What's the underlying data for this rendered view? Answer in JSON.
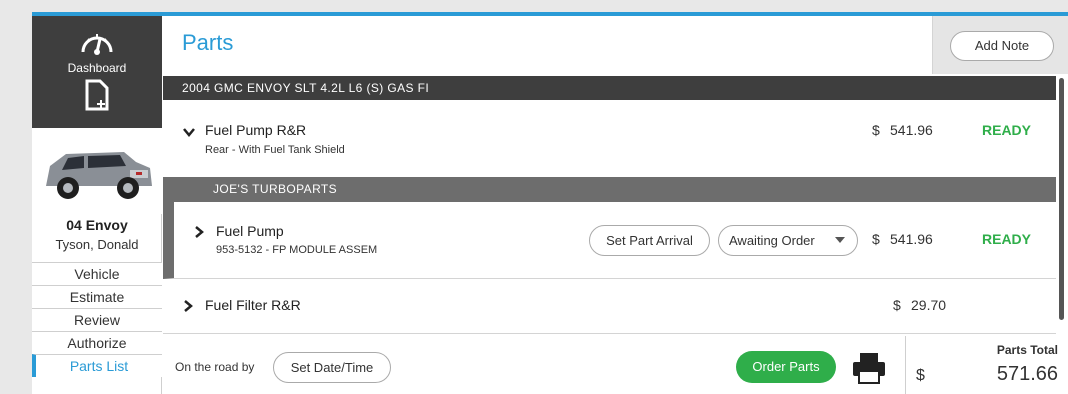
{
  "sidebar": {
    "dashboard_label": "Dashboard",
    "dashboard_icon": "speedometer-icon",
    "new_doc_icon": "new-document-icon",
    "vehicle_short": "04 Envoy",
    "owner": "Tyson, Donald",
    "nav": [
      {
        "label": "Vehicle"
      },
      {
        "label": "Estimate"
      },
      {
        "label": "Review"
      },
      {
        "label": "Authorize"
      },
      {
        "label": "Parts List",
        "active": true
      }
    ]
  },
  "header": {
    "title": "Parts",
    "add_note_label": "Add Note"
  },
  "vehicle_bar": "2004 GMC ENVOY SLT 4.2L L6 (S) GAS FI",
  "jobs": [
    {
      "title": "Fuel Pump R&R",
      "subtitle": "Rear - With Fuel Tank Shield",
      "currency": "$",
      "price": "541.96",
      "status": "READY",
      "expanded": true
    },
    {
      "title": "Fuel Filter R&R",
      "currency": "$",
      "price": "29.70",
      "expanded": false
    }
  ],
  "vendor": {
    "name": "JOE'S TURBOPARTS",
    "part": {
      "title": "Fuel Pump",
      "subtitle": "953-5132 - FP MODULE ASSEM",
      "set_arrival_label": "Set Part Arrival",
      "order_status": "Awaiting Order",
      "currency": "$",
      "price": "541.96",
      "status": "READY"
    }
  },
  "footer": {
    "road_label": "On the road by",
    "set_date_label": "Set Date/Time",
    "order_label": "Order Parts",
    "total_label": "Parts Total",
    "total_currency": "$",
    "total_amount": "571.66"
  },
  "colors": {
    "accent": "#2a9bd6",
    "ready": "#2fae4a",
    "dark": "#3e3e3e",
    "vendor": "#6d6d6d"
  }
}
